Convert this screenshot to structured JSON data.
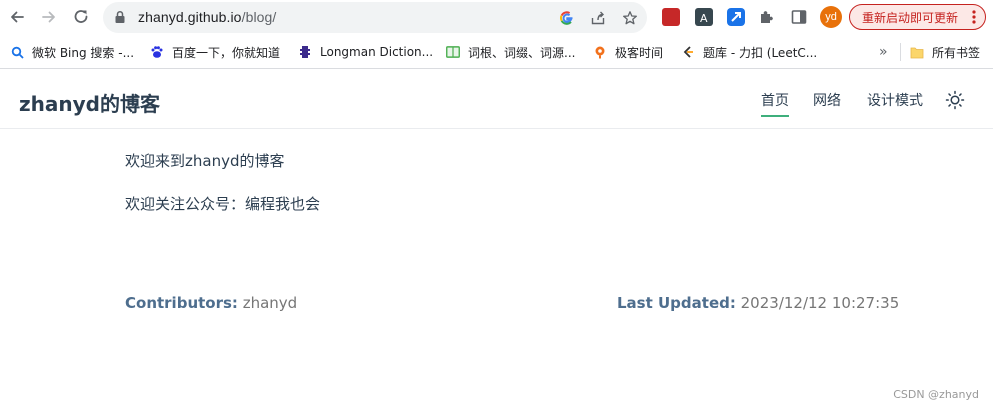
{
  "browser": {
    "url_host": "zhanyd.github.io",
    "url_path": "/blog/",
    "avatar_initials": "yd",
    "update_button_label": "重新启动即可更新"
  },
  "bookmarks": {
    "items": [
      {
        "label": "微软 Bing 搜索 -..."
      },
      {
        "label": "百度一下，你就知道"
      },
      {
        "label": "Longman Diction..."
      },
      {
        "label": "词根、词缀、词源..."
      },
      {
        "label": "极客时间"
      },
      {
        "label": "题库 - 力扣 (LeetC..."
      }
    ],
    "overflow_label": "»",
    "all_bookmarks_label": "所有书签"
  },
  "site": {
    "title": "zhanyd的博客",
    "nav": [
      {
        "label": "首页",
        "active": true
      },
      {
        "label": "网络"
      },
      {
        "label": "设计模式"
      }
    ]
  },
  "content": {
    "paragraph1": "欢迎来到zhanyd的博客",
    "paragraph2": "欢迎关注公众号：编程我也会"
  },
  "footer": {
    "contributors_label": "Contributors:",
    "contributors_value": "zhanyd",
    "last_updated_label": "Last Updated:",
    "last_updated_value": "2023/12/12 10:27:35"
  },
  "watermark": "CSDN @zhanyd",
  "colors": {
    "accent": "#3eaf7c",
    "text": "#2c3e50",
    "update_red": "#c5221f",
    "avatar_orange": "#e8710a"
  }
}
